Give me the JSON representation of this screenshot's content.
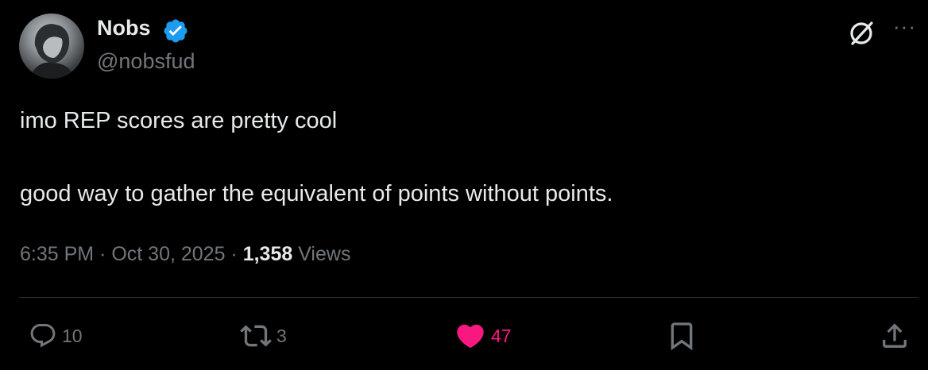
{
  "author": {
    "name": "Nobs",
    "handle": "@nobsfud"
  },
  "tweet": {
    "line1": "imo REP scores are pretty cool",
    "line2": "good way to gather the equivalent of points without points."
  },
  "meta": {
    "time": "6:35 PM",
    "sep1": " · ",
    "date": "Oct 30, 2025",
    "sep2": " · ",
    "views_count": "1,358",
    "views_label": " Views"
  },
  "actions": {
    "replies": "10",
    "reposts": "3",
    "likes": "47"
  },
  "colors": {
    "like": "#f91880",
    "verified": "#1d9bf0",
    "muted": "#71767b"
  }
}
